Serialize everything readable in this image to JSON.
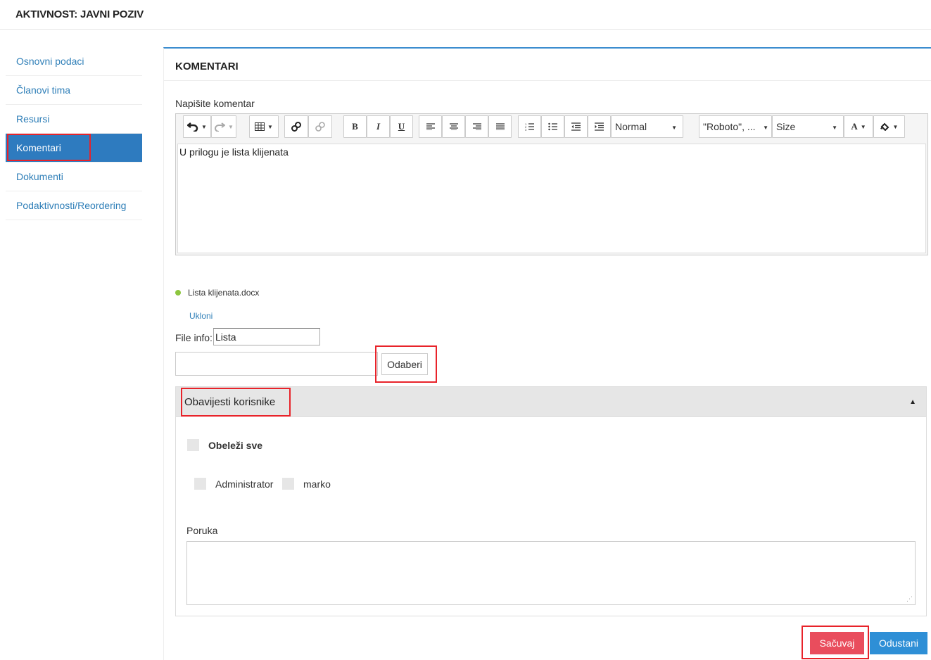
{
  "header": {
    "title": "AKTIVNOST: JAVNI POZIV"
  },
  "sidebar": {
    "items": [
      {
        "label": "Osnovni podaci"
      },
      {
        "label": "Članovi tima"
      },
      {
        "label": "Resursi"
      },
      {
        "label": "Komentari"
      },
      {
        "label": "Dokumenti"
      },
      {
        "label": "Podaktivnosti/Reordering"
      }
    ],
    "active": "Komentari"
  },
  "main": {
    "title": "KOMENTARI",
    "comment_label": "Napišite komentar",
    "editor": {
      "toolbar": {
        "paragraph_style": "Normal",
        "font_family": "\"Roboto\", ...",
        "font_size": "Size",
        "bold": "B",
        "italic": "I",
        "underline": "U",
        "font_color": "A"
      },
      "content": "U prilogu je lista klijenata"
    },
    "attachment": {
      "file_name": "Lista klijenata.docx",
      "remove_label": "Ukloni"
    },
    "file_info": {
      "label": "File info:",
      "value": "Lista"
    },
    "choose_button": "Odaberi",
    "notify": {
      "title": "Obavijesti korisnike",
      "select_all": "Obeleži sve",
      "users": [
        "Administrator",
        "marko"
      ],
      "message_label": "Poruka",
      "message_value": ""
    },
    "actions": {
      "save": "Sačuvaj",
      "cancel": "Odustani"
    }
  },
  "colors": {
    "accent": "#2e7bbf",
    "save": "#e94d5d",
    "cancel": "#2e8fd6",
    "highlight": "#e8232a",
    "status_dot": "#8dc63f"
  }
}
